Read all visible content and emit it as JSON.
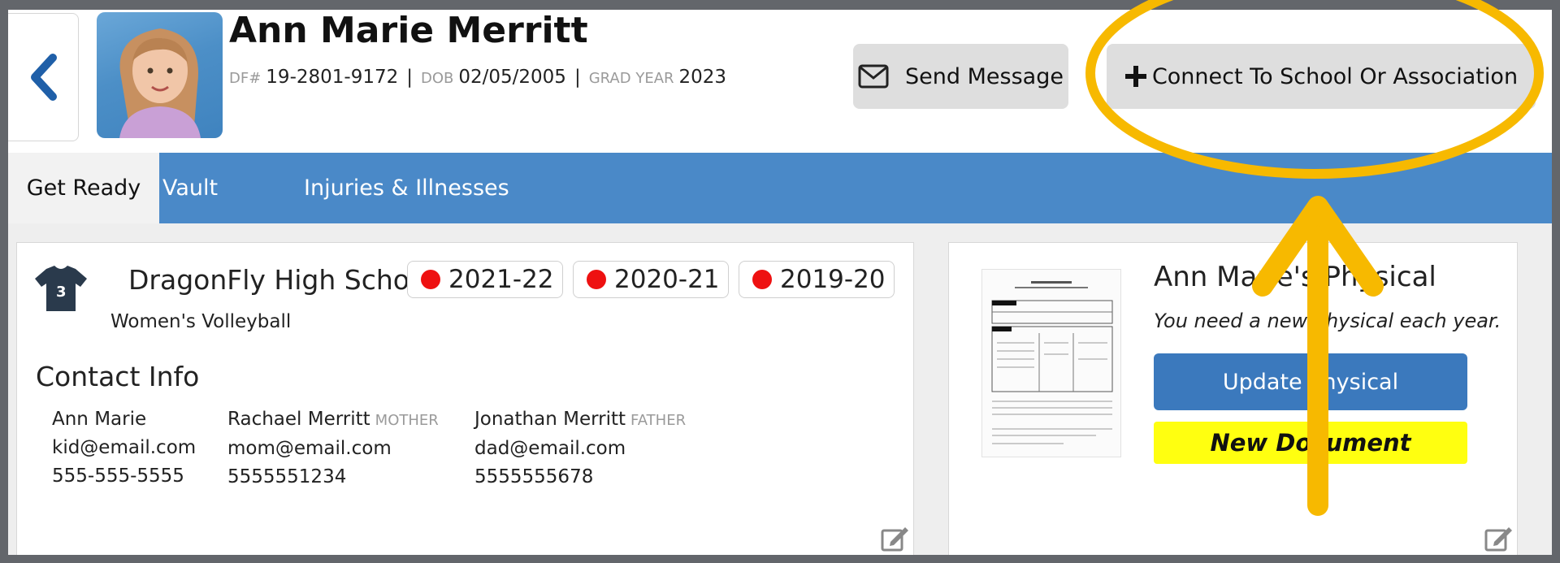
{
  "profile": {
    "name": "Ann Marie Merritt",
    "df_label": "DF#",
    "df_value": "19-2801-9172",
    "dob_label": "DOB",
    "dob_value": "02/05/2005",
    "grad_label": "GRAD YEAR",
    "grad_value": "2023",
    "separator": "|"
  },
  "actions": {
    "send_message": "Send Message",
    "connect": "Connect To School Or Association"
  },
  "tabs": [
    {
      "label": "Get Ready",
      "active": true
    },
    {
      "label": "Vault",
      "active": false
    },
    {
      "label": "Injuries & Illnesses",
      "active": false
    }
  ],
  "school_card": {
    "jersey_number": "3",
    "school": "DragonFly High School",
    "seasons": [
      "2021-22",
      "2020-21",
      "2019-20"
    ],
    "sport": "Women's Volleyball",
    "contact_heading": "Contact Info",
    "contacts": [
      {
        "name": "Ann Marie",
        "relation": "",
        "email": "kid@email.com",
        "phone": "555-555-5555"
      },
      {
        "name": "Rachael Merritt",
        "relation": "MOTHER",
        "email": "mom@email.com",
        "phone": "5555551234"
      },
      {
        "name": "Jonathan Merritt",
        "relation": "FATHER",
        "email": "dad@email.com",
        "phone": "5555555678"
      }
    ]
  },
  "physical_card": {
    "title": "Ann Marie's Physical",
    "subtitle": "You need a new physical each year.",
    "update_button": "Update Physical",
    "badge": "New Document"
  },
  "colors": {
    "tab_bar": "#4a89c8",
    "primary_button": "#3b79bd",
    "season_dot": "#ee1111",
    "annotation": "#f7b900",
    "badge": "#ffff10"
  }
}
